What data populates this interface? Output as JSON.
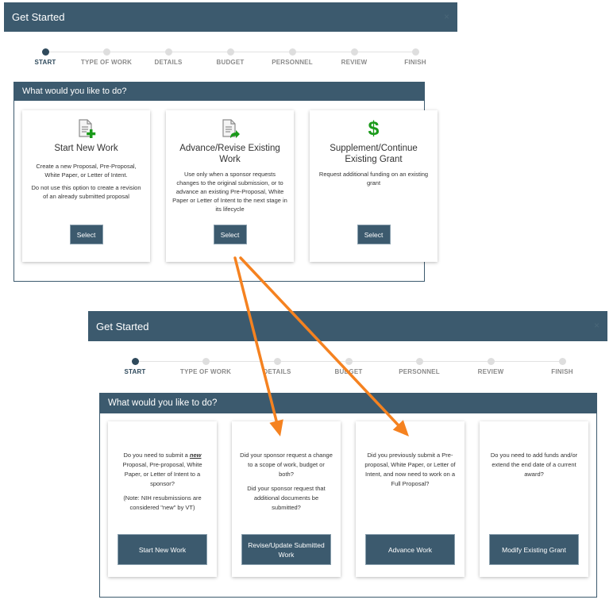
{
  "modal_top": {
    "title": "Get Started",
    "close": "×",
    "steps": [
      {
        "label": "START",
        "active": true
      },
      {
        "label": "TYPE OF WORK",
        "active": false
      },
      {
        "label": "DETAILS",
        "active": false
      },
      {
        "label": "BUDGET",
        "active": false
      },
      {
        "label": "PERSONNEL",
        "active": false
      },
      {
        "label": "REVIEW",
        "active": false
      },
      {
        "label": "FINISH",
        "active": false
      }
    ],
    "panel_title": "What would you like to do?",
    "cards": [
      {
        "icon": "document-add-icon",
        "title": "Start New Work",
        "desc": [
          "Create a new Proposal, Pre-Proposal, White Paper, or Letter of Intent.",
          "Do not use this option to create a revision of an already submitted proposal"
        ],
        "button": "Select"
      },
      {
        "icon": "document-forward-icon",
        "title": "Advance/Revise Existing Work",
        "desc": [
          "Use only when a sponsor requests changes to the original submission, or to advance an existing Pre-Proposal, White Paper or Letter of Intent to the next stage in its lifecycle"
        ],
        "button": "Select"
      },
      {
        "icon": "dollar-icon",
        "title": "Supplement/Continue Existing Grant",
        "desc": [
          "Request additional funding on an existing grant"
        ],
        "button": "Select"
      }
    ]
  },
  "modal_bottom": {
    "title": "Get Started",
    "close": "×",
    "steps": [
      {
        "label": "START",
        "active": true
      },
      {
        "label": "TYPE OF WORK",
        "active": false
      },
      {
        "label": "DETAILS",
        "active": false
      },
      {
        "label": "BUDGET",
        "active": false
      },
      {
        "label": "PERSONNEL",
        "active": false
      },
      {
        "label": "REVIEW",
        "active": false
      },
      {
        "label": "FINISH",
        "active": false
      }
    ],
    "panel_title": "What would you like to do?",
    "cards": [
      {
        "q1_pre": "Do you need to submit a ",
        "q1_em": "new",
        "q1_post": " Proposal, Pre-proposal, White Paper, or Letter of Intent to a sponsor?",
        "q2": "(Note: NIH resubmissions are considered \"new\" by VT)",
        "button": "Start New Work"
      },
      {
        "q1": "Did your sponsor request a change to a scope of work, budget or both?",
        "q2": "Did your sponsor request that additional documents be submitted?",
        "button": "Revise/Update Submitted Work"
      },
      {
        "q1": "Did you previously submit a Pre-proposal, White Paper, or Letter of Intent, and now need to work on a Full Proposal?",
        "button": "Advance Work"
      },
      {
        "q1": "Do you need to add funds and/or extend the end date of a current award?",
        "button": "Modify Existing Grant"
      }
    ]
  },
  "annotations": {
    "arrow_color": "#f58220"
  },
  "colors": {
    "header": "#3c5a6e",
    "active_step": "#2f4a5c",
    "inactive_step": "#dedede",
    "icon_green": "#1a9a1a"
  }
}
